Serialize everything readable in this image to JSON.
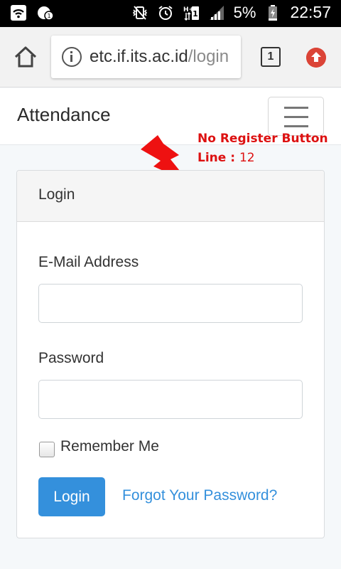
{
  "status_bar": {
    "battery": "5%",
    "time": "22:57"
  },
  "browser": {
    "url_domain": "etc.if.its.ac.id",
    "url_path": "/login",
    "tab_count": "1"
  },
  "navbar": {
    "brand": "Attendance"
  },
  "annotation": {
    "title": "No Register Button",
    "line_label": "Line :",
    "line_number": "12",
    "color": "#dd1111"
  },
  "login_card": {
    "header": "Login",
    "email_label": "E-Mail Address",
    "email_value": "",
    "password_label": "Password",
    "password_value": "",
    "remember_label": "Remember Me",
    "remember_checked": false,
    "login_button": "Login",
    "forgot_link": "Forgot Your Password?"
  },
  "colors": {
    "primary": "#3490dc",
    "update_badge": "#db4437"
  },
  "icons": [
    "wifi-icon",
    "notification-icon",
    "vibrate-icon",
    "alarm-icon",
    "network-h-plus-icon",
    "signal-icon",
    "battery-icon",
    "home-icon",
    "info-icon",
    "tabs-icon",
    "update-icon",
    "hamburger-icon",
    "lightning-icon"
  ]
}
